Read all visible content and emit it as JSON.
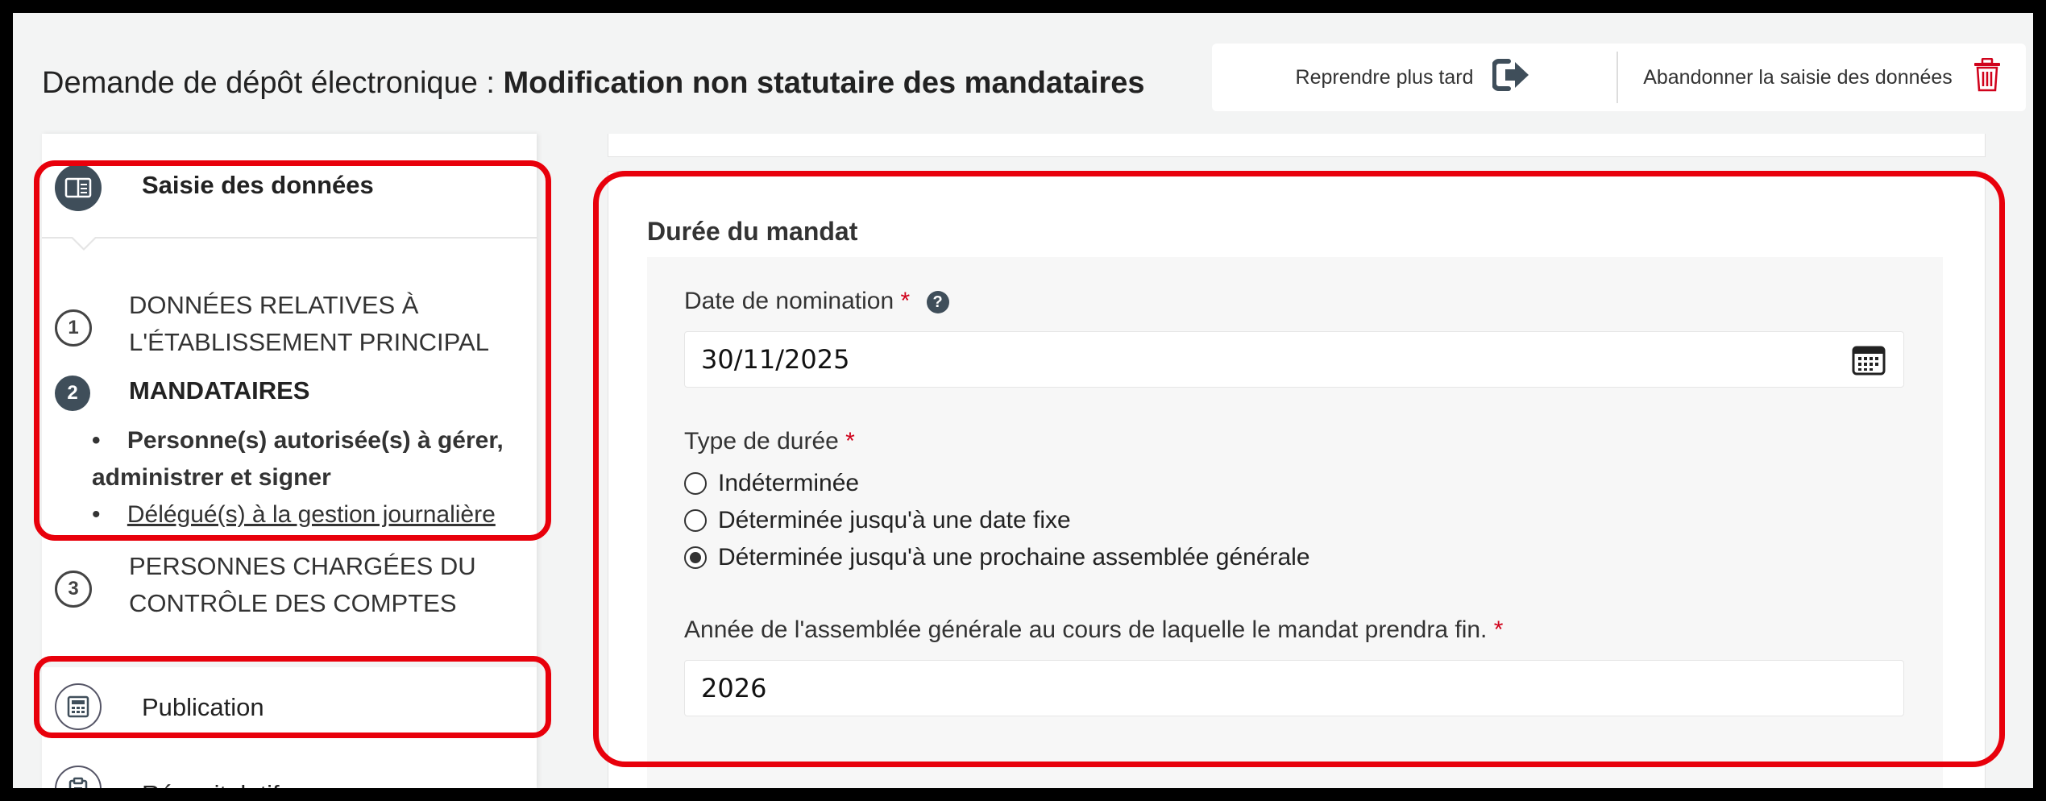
{
  "header": {
    "title_prefix": "Demande de dépôt électronique : ",
    "title_main": "Modification non statutaire des mandataires",
    "resume_label": "Reprendre plus tard",
    "abandon_label": "Abandonner la saisie des données"
  },
  "sidebar": {
    "section_title": "Saisie des données",
    "steps": [
      {
        "number": "1",
        "label": "DONNÉES RELATIVES À L'ÉTABLISSEMENT PRINCIPAL"
      },
      {
        "number": "2",
        "label": "MANDATAIRES"
      },
      {
        "number": "3",
        "label": "PERSONNES CHARGÉES DU CONTRÔLE DES COMPTES"
      }
    ],
    "sub_items": [
      {
        "bullet": "•",
        "label": "Personne(s) autorisée(s) à gérer, administrer et signer"
      },
      {
        "bullet": "•",
        "label": "Délégué(s) à la gestion journalière"
      }
    ],
    "publication_label": "Publication",
    "recap_label": "Récapitulatif"
  },
  "form": {
    "section_title": "Durée du mandat",
    "date_label": "Date de nomination",
    "required_mark": "*",
    "help_glyph": "?",
    "date_value": "30/11/2025",
    "type_label": "Type de durée",
    "options": [
      {
        "label": "Indéterminée",
        "selected": false
      },
      {
        "label": "Déterminée jusqu'à une date fixe",
        "selected": false
      },
      {
        "label": "Déterminée jusqu'à une prochaine assemblée générale",
        "selected": true
      }
    ],
    "year_label": "Année de l'assemblée générale au cours de laquelle le mandat prendra fin.",
    "year_value": "2026"
  },
  "icons": {
    "resume": "sign-out-arrow-icon",
    "abandon": "trash-icon",
    "section": "book-icon",
    "publication": "newspaper-icon",
    "recap": "clipboard-icon",
    "calendar": "calendar-icon"
  },
  "colors": {
    "highlight": "#e8000b",
    "dark_circle": "#3f4e5a",
    "trash": "#d0021b",
    "required": "#d0021b"
  }
}
